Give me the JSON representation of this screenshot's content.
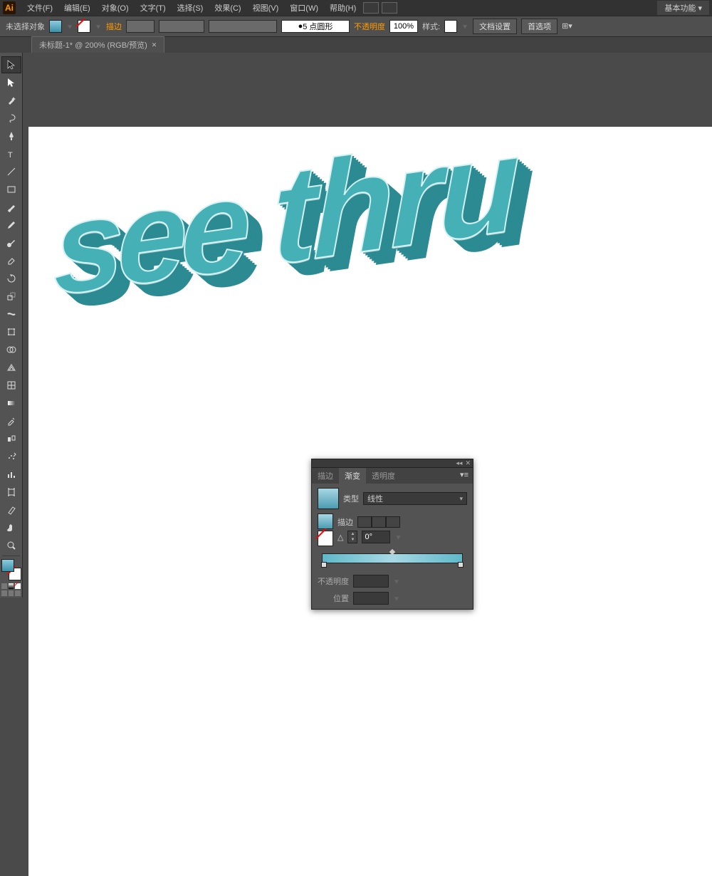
{
  "menubar": {
    "items": [
      "文件(F)",
      "编辑(E)",
      "对象(O)",
      "文字(T)",
      "选择(S)",
      "效果(C)",
      "视图(V)",
      "窗口(W)",
      "帮助(H)"
    ],
    "workspace": "基本功能"
  },
  "controlbar": {
    "selection_status": "未选择对象",
    "stroke_label": "描边",
    "stroke_weight": "5 点圆形",
    "opacity_label": "不透明度",
    "opacity_value": "100%",
    "style_label": "样式:",
    "doc_setup": "文档设置",
    "prefs": "首选项"
  },
  "document_tab": {
    "title": "未标题-1* @ 200% (RGB/预览)"
  },
  "tools": {
    "names": [
      "selection",
      "direct-selection",
      "magic-wand",
      "lasso",
      "pen",
      "type",
      "line",
      "rectangle",
      "paintbrush",
      "pencil",
      "blob-brush",
      "eraser",
      "rotate",
      "scale",
      "width",
      "free-transform",
      "shape-builder",
      "perspective-grid",
      "mesh",
      "gradient",
      "eyedropper",
      "blend",
      "symbol-sprayer",
      "column-graph",
      "artboard",
      "slice",
      "hand",
      "zoom"
    ]
  },
  "artwork": {
    "word1": "see",
    "word2": "thru"
  },
  "gradient_panel": {
    "tabs": [
      "描边",
      "渐变",
      "透明度"
    ],
    "active_tab": 1,
    "type_label": "类型",
    "type_value": "线性",
    "stroke_label": "描边",
    "angle_icon": "△",
    "angle_value": "0°",
    "opacity_label": "不透明度",
    "opacity_value": "",
    "location_label": "位置",
    "location_value": ""
  }
}
